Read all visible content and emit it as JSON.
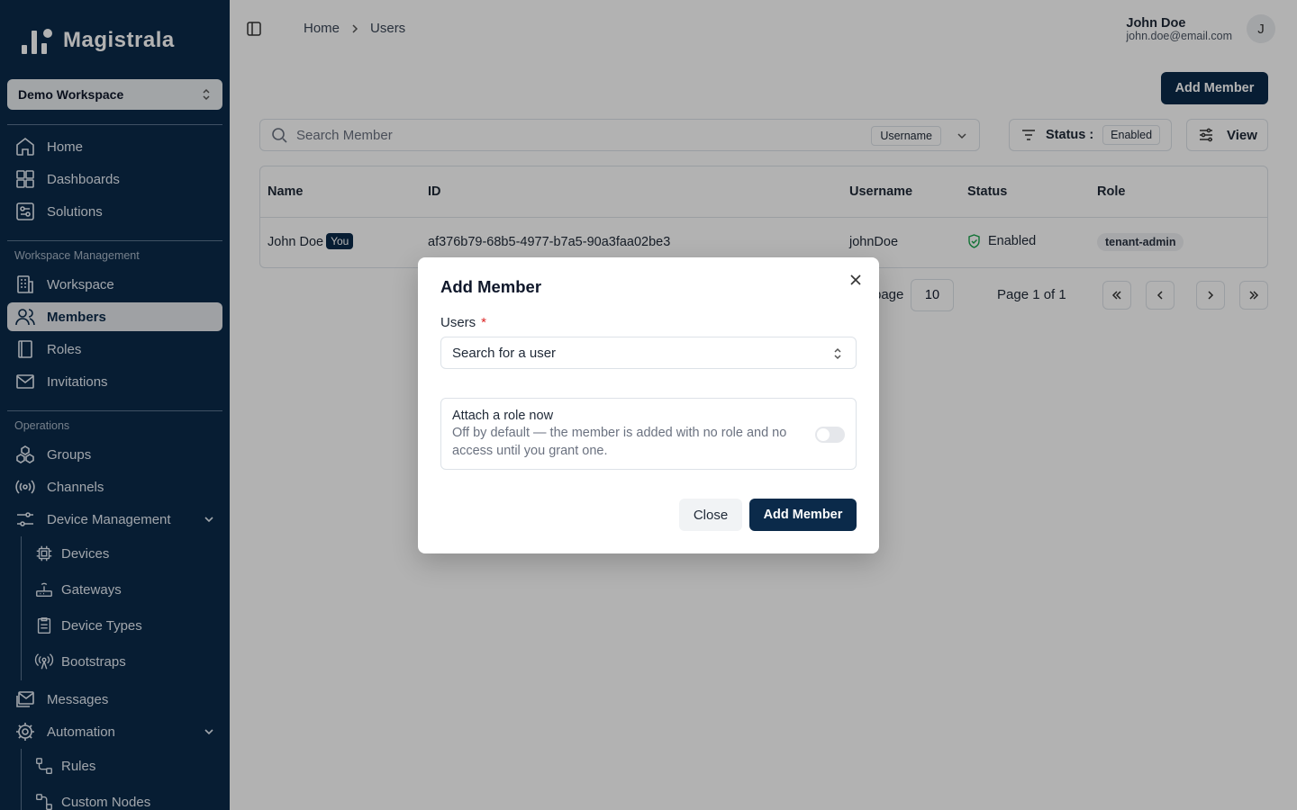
{
  "app": {
    "name": "Magistrala"
  },
  "workspace": {
    "selected": "Demo Workspace"
  },
  "sidebar": {
    "main": [
      {
        "label": "Home",
        "icon": "home-icon"
      },
      {
        "label": "Dashboards",
        "icon": "dashboards-icon"
      },
      {
        "label": "Solutions",
        "icon": "solutions-icon"
      }
    ],
    "workspace_section": "Workspace Management",
    "workspace_items": [
      {
        "label": "Workspace",
        "icon": "building-icon"
      },
      {
        "label": "Members",
        "icon": "users-icon",
        "active": true
      },
      {
        "label": "Roles",
        "icon": "book-icon"
      },
      {
        "label": "Invitations",
        "icon": "mail-icon"
      }
    ],
    "operations_section": "Operations",
    "operations_items": [
      {
        "label": "Groups",
        "icon": "groups-icon"
      },
      {
        "label": "Channels",
        "icon": "broadcast-icon"
      },
      {
        "label": "Device Management",
        "icon": "sliders-icon"
      }
    ],
    "device_sub": [
      {
        "label": "Devices",
        "icon": "chip-icon"
      },
      {
        "label": "Gateways",
        "icon": "router-icon"
      },
      {
        "label": "Device Types",
        "icon": "clipboard-icon"
      },
      {
        "label": "Bootstraps",
        "icon": "antenna-icon"
      }
    ],
    "more_items": [
      {
        "label": "Messages",
        "icon": "message-mail-icon"
      },
      {
        "label": "Automation",
        "icon": "gear-icon"
      }
    ],
    "automation_sub": [
      {
        "label": "Rules",
        "icon": "rules-icon"
      },
      {
        "label": "Custom Nodes",
        "icon": "nodes-icon"
      }
    ]
  },
  "breadcrumb": {
    "home": "Home",
    "current": "Users"
  },
  "user": {
    "name": "John Doe",
    "email": "john.doe@email.com",
    "initial": "J"
  },
  "toolbar": {
    "add_member": "Add Member",
    "search_placeholder": "Search Member",
    "search_field": "Username",
    "status_label": "Status :",
    "status_value": "Enabled",
    "view_label": "View"
  },
  "table": {
    "headers": {
      "name": "Name",
      "id": "ID",
      "username": "Username",
      "status": "Status",
      "role": "Role"
    },
    "rows": [
      {
        "name": "John Doe",
        "badge": "You",
        "id": "af376b79-68b5-4977-b7a5-90a3faa02be3",
        "username": "johnDoe",
        "status": "Enabled",
        "role": "tenant-admin"
      }
    ]
  },
  "pagination": {
    "label_fragment": "page",
    "page_size": "10",
    "page_text": "Page 1 of 1"
  },
  "modal": {
    "title": "Add Member",
    "users_label": "Users",
    "required_mark": "*",
    "user_placeholder": "Search for a user",
    "role_title": "Attach a role now",
    "role_desc": "Off by default — the member is added with no role and no access until you grant one.",
    "role_toggle_on": false,
    "close": "Close",
    "submit": "Add Member"
  },
  "colors": {
    "brand": "#0b2a4a",
    "required": "#dc2626",
    "status_ok": "#16a34a"
  }
}
